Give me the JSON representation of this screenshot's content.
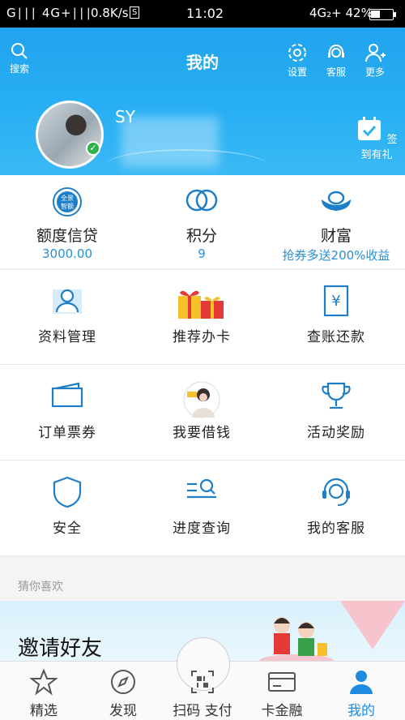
{
  "status_bar": {
    "left": "G∣∣∣ 4G+∣∣∣",
    "speed": "0.8K/s",
    "s_badge": "S",
    "time": "11:02",
    "right": "4G₂+ 42%"
  },
  "header": {
    "title": "我的",
    "search_label": "搜索",
    "settings_label": "设置",
    "service_label": "客服",
    "more_label": "更多",
    "username": "SY",
    "checkin_label": "签到有礼"
  },
  "stats": [
    {
      "title": "额度信贷",
      "value": "3000.00",
      "icon": "credit-badge-icon",
      "icon_text": "全景\n智额"
    },
    {
      "title": "积分",
      "value": "9",
      "icon": "points-icon"
    },
    {
      "title": "财富",
      "value": "抢券多送200%收益",
      "icon": "gold-ingot-icon"
    }
  ],
  "grid": [
    [
      {
        "label": "资料管理",
        "icon": "profile-icon"
      },
      {
        "label": "推荐办卡",
        "icon": "gift-icon"
      },
      {
        "label": "查账还款",
        "icon": "bill-icon"
      }
    ],
    [
      {
        "label": "订单票券",
        "icon": "ticket-icon"
      },
      {
        "label": "我要借钱",
        "icon": "loan-avatar-icon"
      },
      {
        "label": "活动奖励",
        "icon": "trophy-icon"
      }
    ],
    [
      {
        "label": "安全",
        "icon": "shield-icon"
      },
      {
        "label": "进度查询",
        "icon": "progress-search-icon"
      },
      {
        "label": "我的客服",
        "icon": "headset-icon"
      }
    ]
  ],
  "guess": {
    "title": "猜你喜欢"
  },
  "banner": {
    "text": "邀请好友"
  },
  "bottom_nav": [
    {
      "label": "精选",
      "icon": "star-icon",
      "active": false
    },
    {
      "label": "发现",
      "icon": "compass-icon",
      "active": false
    },
    {
      "label": "扫码 支付",
      "icon": "scan-icon",
      "active": false
    },
    {
      "label": "卡金融",
      "icon": "card-icon",
      "active": false
    },
    {
      "label": "我的",
      "icon": "person-icon",
      "active": true
    }
  ],
  "colors": {
    "header": "#21a3ee",
    "accent": "#1e8be0",
    "value": "#2a8fd6",
    "icon": "#1e7ec8"
  }
}
